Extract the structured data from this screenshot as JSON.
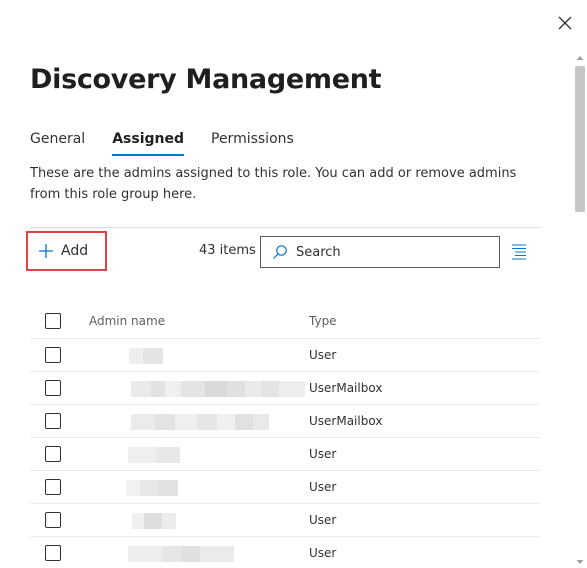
{
  "panel": {
    "title": "Discovery Management",
    "description": "These are the admins assigned to this role. You can add or remove admins from this role group here."
  },
  "tabs": [
    {
      "label": "General",
      "active": false
    },
    {
      "label": "Assigned",
      "active": true
    },
    {
      "label": "Permissions",
      "active": false
    }
  ],
  "toolbar": {
    "add_label": "Add",
    "items_count": "43 items",
    "search_placeholder": "Search"
  },
  "table": {
    "columns": [
      "Admin name",
      "Type"
    ],
    "rows": [
      {
        "type": "User"
      },
      {
        "type": "UserMailbox"
      },
      {
        "type": "UserMailbox"
      },
      {
        "type": "User"
      },
      {
        "type": "User"
      },
      {
        "type": "User"
      },
      {
        "type": "User"
      }
    ]
  },
  "icons": {
    "close": "close-icon",
    "add": "plus-icon",
    "search": "search-icon",
    "view": "view-options-icon"
  },
  "colors": {
    "accent": "#0078d4",
    "highlight_border": "#e04343"
  }
}
